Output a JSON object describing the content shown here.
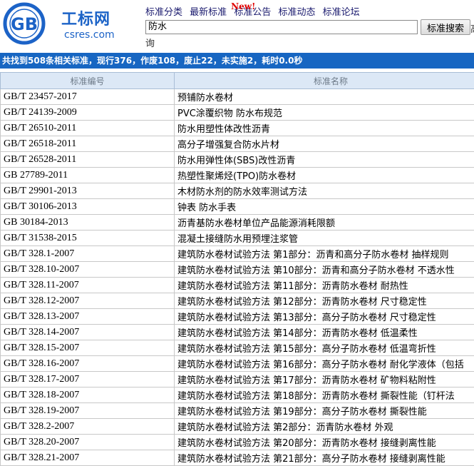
{
  "site": {
    "logo_cn": "工标网",
    "logo_en": "csres.com",
    "logo_letters": "GB"
  },
  "nav": {
    "items": [
      "标准分类",
      "最新标准",
      "标准公告",
      "标准动态",
      "标准论坛"
    ],
    "new_badge": "New!"
  },
  "search": {
    "value": "防水",
    "button_label": "标准搜索",
    "extra_label_1": "高",
    "extra_label_2": "询"
  },
  "summary": "共找到508条相关标准，现行376，作废108，废止22，未实施2，耗时0.0秒",
  "table": {
    "headers": [
      "标准编号",
      "标准名称"
    ],
    "rows": [
      {
        "code": "GB/T 23457-2017",
        "name": "预铺防水卷材"
      },
      {
        "code": "GB/T 24139-2009",
        "name": "PVC涂覆织物 防水布规范"
      },
      {
        "code": "GB/T 26510-2011",
        "name": "防水用塑性体改性沥青"
      },
      {
        "code": "GB/T 26518-2011",
        "name": "高分子增强复合防水片材"
      },
      {
        "code": "GB/T 26528-2011",
        "name": "防水用弹性体(SBS)改性沥青"
      },
      {
        "code": "GB 27789-2011",
        "name": "热塑性聚烯烃(TPO)防水卷材"
      },
      {
        "code": "GB/T 29901-2013",
        "name": "木材防水剂的防水效率测试方法"
      },
      {
        "code": "GB/T 30106-2013",
        "name": "钟表 防水手表"
      },
      {
        "code": "GB 30184-2013",
        "name": "沥青基防水卷材单位产品能源消耗限额"
      },
      {
        "code": "GB/T 31538-2015",
        "name": "混凝土接缝防水用预埋注浆管"
      },
      {
        "code": "GB/T 328.1-2007",
        "name": "建筑防水卷材试验方法 第1部分：沥青和高分子防水卷材 抽样规则"
      },
      {
        "code": "GB/T 328.10-2007",
        "name": "建筑防水卷材试验方法 第10部分：沥青和高分子防水卷材 不透水性"
      },
      {
        "code": "GB/T 328.11-2007",
        "name": "建筑防水卷材试验方法 第11部分：沥青防水卷材 耐热性"
      },
      {
        "code": "GB/T 328.12-2007",
        "name": "建筑防水卷材试验方法 第12部分：沥青防水卷材 尺寸稳定性"
      },
      {
        "code": "GB/T 328.13-2007",
        "name": "建筑防水卷材试验方法 第13部分：高分子防水卷材 尺寸稳定性"
      },
      {
        "code": "GB/T 328.14-2007",
        "name": "建筑防水卷材试验方法 第14部分：沥青防水卷材 低温柔性"
      },
      {
        "code": "GB/T 328.15-2007",
        "name": "建筑防水卷材试验方法 第15部分：高分子防水卷材 低温弯折性"
      },
      {
        "code": "GB/T 328.16-2007",
        "name": "建筑防水卷材试验方法 第16部分：高分子防水卷材 耐化学液体（包括"
      },
      {
        "code": "GB/T 328.17-2007",
        "name": "建筑防水卷材试验方法 第17部分：沥青防水卷材 矿物料粘附性"
      },
      {
        "code": "GB/T 328.18-2007",
        "name": "建筑防水卷材试验方法 第18部分：沥青防水卷材 撕裂性能（钉杆法"
      },
      {
        "code": "GB/T 328.19-2007",
        "name": "建筑防水卷材试验方法 第19部分：高分子防水卷材 撕裂性能"
      },
      {
        "code": "GB/T 328.2-2007",
        "name": "建筑防水卷材试验方法 第2部分：沥青防水卷材 外观"
      },
      {
        "code": "GB/T 328.20-2007",
        "name": "建筑防水卷材试验方法 第20部分：沥青防水卷材 接缝剥离性能"
      },
      {
        "code": "GB/T 328.21-2007",
        "name": "建筑防水卷材试验方法 第21部分：高分子防水卷材 接缝剥离性能"
      }
    ]
  },
  "colors": {
    "brand_blue": "#1c63c7",
    "summary_bar": "#1766c2",
    "header_cell": "#dce8f6",
    "new_badge": "#e00000"
  }
}
